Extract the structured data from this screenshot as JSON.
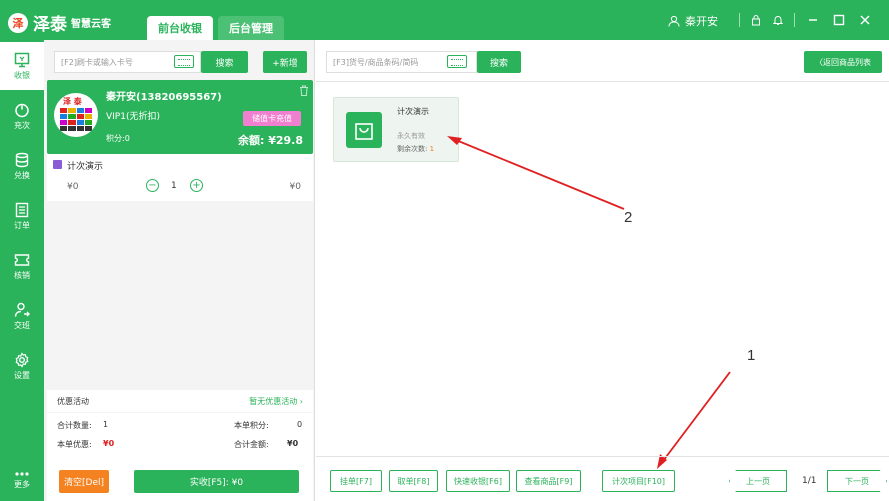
{
  "app": {
    "logo_mark": "泽",
    "name": "泽泰",
    "subtitle": "智慧云客"
  },
  "tabs": [
    {
      "label": "前台收银"
    },
    {
      "label": "后台管理"
    }
  ],
  "user": {
    "name": "秦开安"
  },
  "sidebar": {
    "items": [
      {
        "label": "收银",
        "icon": "monitor-icon"
      },
      {
        "label": "充次",
        "icon": "power-icon"
      },
      {
        "label": "兑换",
        "icon": "database-icon"
      },
      {
        "label": "订单",
        "icon": "document-icon"
      },
      {
        "label": "核销",
        "icon": "ticket-icon"
      },
      {
        "label": "交班",
        "icon": "person-icon"
      },
      {
        "label": "设置",
        "icon": "gear-icon"
      },
      {
        "label": "更多",
        "icon": "more-icon"
      }
    ]
  },
  "left": {
    "search_placeholder": "[F2]刷卡或输入卡号",
    "search_btn": "搜索",
    "add_btn": "+新增",
    "member": {
      "name": "秦开安(13820695567)",
      "level": "VIP1(无折扣)",
      "points": "积分:0",
      "recharge_btn": "储值卡充值",
      "balance": "余额: ¥29.8"
    },
    "cart": {
      "item_name": "计次演示",
      "price": "¥0",
      "qty": "1",
      "total": "¥0"
    },
    "promo_label": "优惠活动",
    "promo_value": "暂无优惠活动",
    "summary": {
      "qty_label": "合计数量:",
      "qty_value": "1",
      "points_label": "本单积分:",
      "points_value": "0",
      "discount_label": "本单优惠:",
      "discount_value": "¥0",
      "total_label": "合计金额:",
      "total_value": "¥0"
    },
    "clear_btn": "清空[Del]",
    "pay_btn": "实收[F5]: ¥0"
  },
  "right": {
    "search_placeholder": "[F3]货号/商品条码/简码",
    "search_btn": "搜索",
    "back_btn": "〈返回商品列表",
    "product": {
      "name": "计次演示",
      "validity": "永久有效",
      "remaining_label": "剩余次数:",
      "remaining_value": "1"
    },
    "annotations": [
      "1",
      "2"
    ],
    "bottom_buttons": [
      "挂单[F7]",
      "取单[F8]",
      "快速收银[F6]",
      "查看商品[F9]",
      "计次项目[F10]"
    ],
    "prev_btn": "上一页",
    "page": "1/1",
    "next_btn": "下一页"
  },
  "colors": {
    "brand": "#2bb35b",
    "recharge": "#f07fcf",
    "danger": "#e02020",
    "clear": "#f58220"
  }
}
